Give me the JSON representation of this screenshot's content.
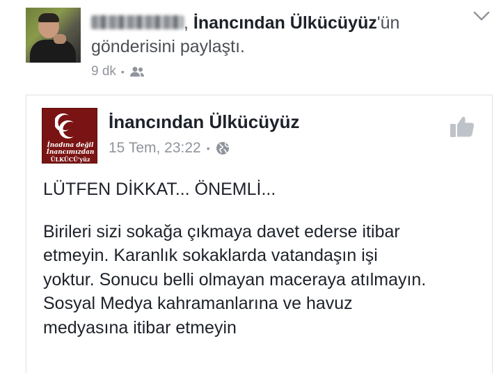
{
  "share": {
    "sharer_name": "Furkan Ağca",
    "separator": ",",
    "page_name": "İnancından Ülkücüyüz",
    "suffix": "'ün",
    "action_text": "gönderisini paylaştı.",
    "time": "9 dk",
    "meta_dot": "•",
    "privacy_icon": "friends-icon",
    "menu_icon": "chevron-down-icon"
  },
  "post": {
    "page_name": "İnancından Ülkücüyüz",
    "avatar_caption": [
      "İnadına değil",
      "İnancımızdan",
      "ÜLKÜCÜ'yüz"
    ],
    "date": "15 Tem, 23:22",
    "meta_dot": "•",
    "privacy_icon": "globe-icon",
    "like_icon": "thumbs-up-icon",
    "headline": "LÜTFEN DİKKAT... ÖNEMLİ...",
    "body_lines": [
      "Birileri sizi sokağa çıkmaya davet ederse itibar",
      "etmeyin. Karanlık sokaklarda vatandaşın işi",
      "yoktur. Sonucu belli olmayan maceraya atılmayın.",
      "Sosyal Medya kahramanlarına ve havuz",
      "medyasına itibar etmeyin"
    ]
  },
  "colors": {
    "text": "#1d2129",
    "secondary": "#90949c",
    "card_border": "#dddfe2",
    "page_avatar_bg": "#7a1414"
  }
}
